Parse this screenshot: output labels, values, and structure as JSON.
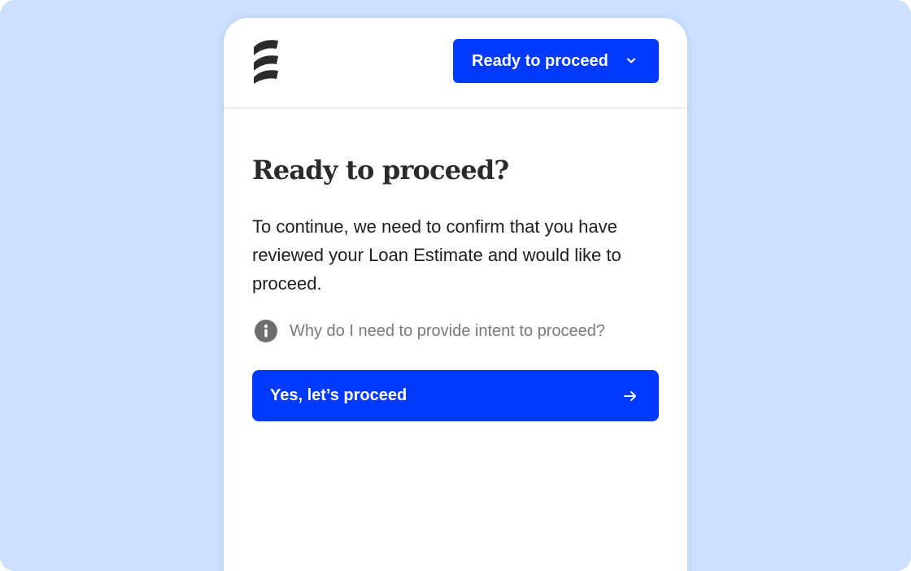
{
  "header": {
    "logo_icon": "stacked-stripes-logo",
    "status_button": {
      "label": "Ready to proceed",
      "icon": "chevron-down-icon"
    }
  },
  "main": {
    "title": "Ready to proceed?",
    "description": "To continue, we need to confirm that you have reviewed your Loan Estimate and would like to proceed.",
    "info_link": {
      "icon": "info-icon",
      "label": "Why do I need to provide intent to proceed?"
    },
    "primary_button": {
      "label": "Yes, let’s proceed",
      "icon": "arrow-right-icon"
    }
  },
  "colors": {
    "background": "#cce0ff",
    "accent": "#0039ff",
    "text": "#1e1e1e",
    "muted_text": "#7a7a7a"
  }
}
